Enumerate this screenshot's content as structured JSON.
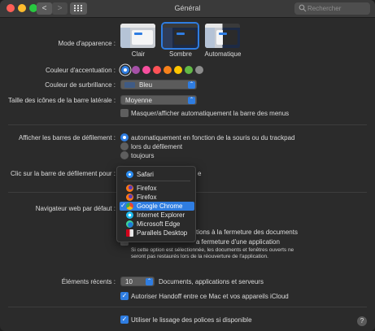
{
  "window": {
    "title": "Général"
  },
  "toolbar": {
    "back_label": "<",
    "forward_label": ">"
  },
  "search": {
    "placeholder": "Rechercher"
  },
  "appearance": {
    "label": "Mode d'apparence :",
    "options": [
      {
        "label": "Clair",
        "selected": false
      },
      {
        "label": "Sombre",
        "selected": true
      },
      {
        "label": "Automatique",
        "selected": false
      }
    ]
  },
  "accent": {
    "label": "Couleur d'accentuation :",
    "colors": [
      "#2f7de1",
      "#a550a7",
      "#f74f9e",
      "#ff5257",
      "#f7821b",
      "#ffc600",
      "#62ba46",
      "#8c8c8c"
    ],
    "selected_index": 0
  },
  "highlight": {
    "label": "Couleur de surbrillance :",
    "value": "Bleu",
    "swatch": "#3f5b85"
  },
  "sidebar_icons": {
    "label": "Taille des icônes de la barre latérale :",
    "value": "Moyenne"
  },
  "menubar_autohide": {
    "label": "Masquer/afficher automatiquement la barre des menus",
    "checked": false
  },
  "scrollbars": {
    "label": "Afficher les barres de défilement :",
    "options": [
      {
        "label": "automatiquement en fonction de la souris ou du trackpad",
        "selected": true
      },
      {
        "label": "lors du défilement",
        "selected": false
      },
      {
        "label": "toujours",
        "selected": false
      }
    ]
  },
  "scroll_click": {
    "label": "Clic sur la barre de défilement pour :",
    "option_tail": "e"
  },
  "default_browser": {
    "label": "Navigateur web par défaut :",
    "menu": [
      {
        "label": "Safari",
        "icon": "safari-icon",
        "checked": false,
        "highlighted": false
      },
      {
        "label": "Firefox",
        "icon": "firefox-icon",
        "checked": false,
        "highlighted": false
      },
      {
        "label": "Firefox",
        "icon": "firefox-icon",
        "checked": false,
        "highlighted": false
      },
      {
        "label": "Google Chrome",
        "icon": "chrome-icon",
        "checked": true,
        "highlighted": true
      },
      {
        "label": "Internet Explorer",
        "icon": "internet-explorer-icon",
        "checked": false,
        "highlighted": false
      },
      {
        "label": "Microsoft Edge",
        "icon": "edge-icon",
        "checked": false,
        "highlighted": false
      },
      {
        "label": "Parallels Desktop",
        "icon": "parallels-icon",
        "checked": false,
        "highlighted": false
      }
    ]
  },
  "windows": {
    "close_docs_tail": "tions à la fermeture des documents",
    "close_app_tail": "a fermeture d'une application",
    "note": "Si cette option est sélectionnée, les documents et fenêtres ouverts ne seront pas restaurés lors de la réouverture de l'application."
  },
  "recent_items": {
    "label": "Éléments récents :",
    "value": "10",
    "suffix": "Documents, applications et serveurs"
  },
  "handoff": {
    "label": "Autoriser Handoff entre ce Mac et vos appareils iCloud",
    "checked": true
  },
  "font_smoothing": {
    "label": "Utiliser le lissage des polices si disponible",
    "checked": true
  },
  "help": {
    "label": "?"
  }
}
